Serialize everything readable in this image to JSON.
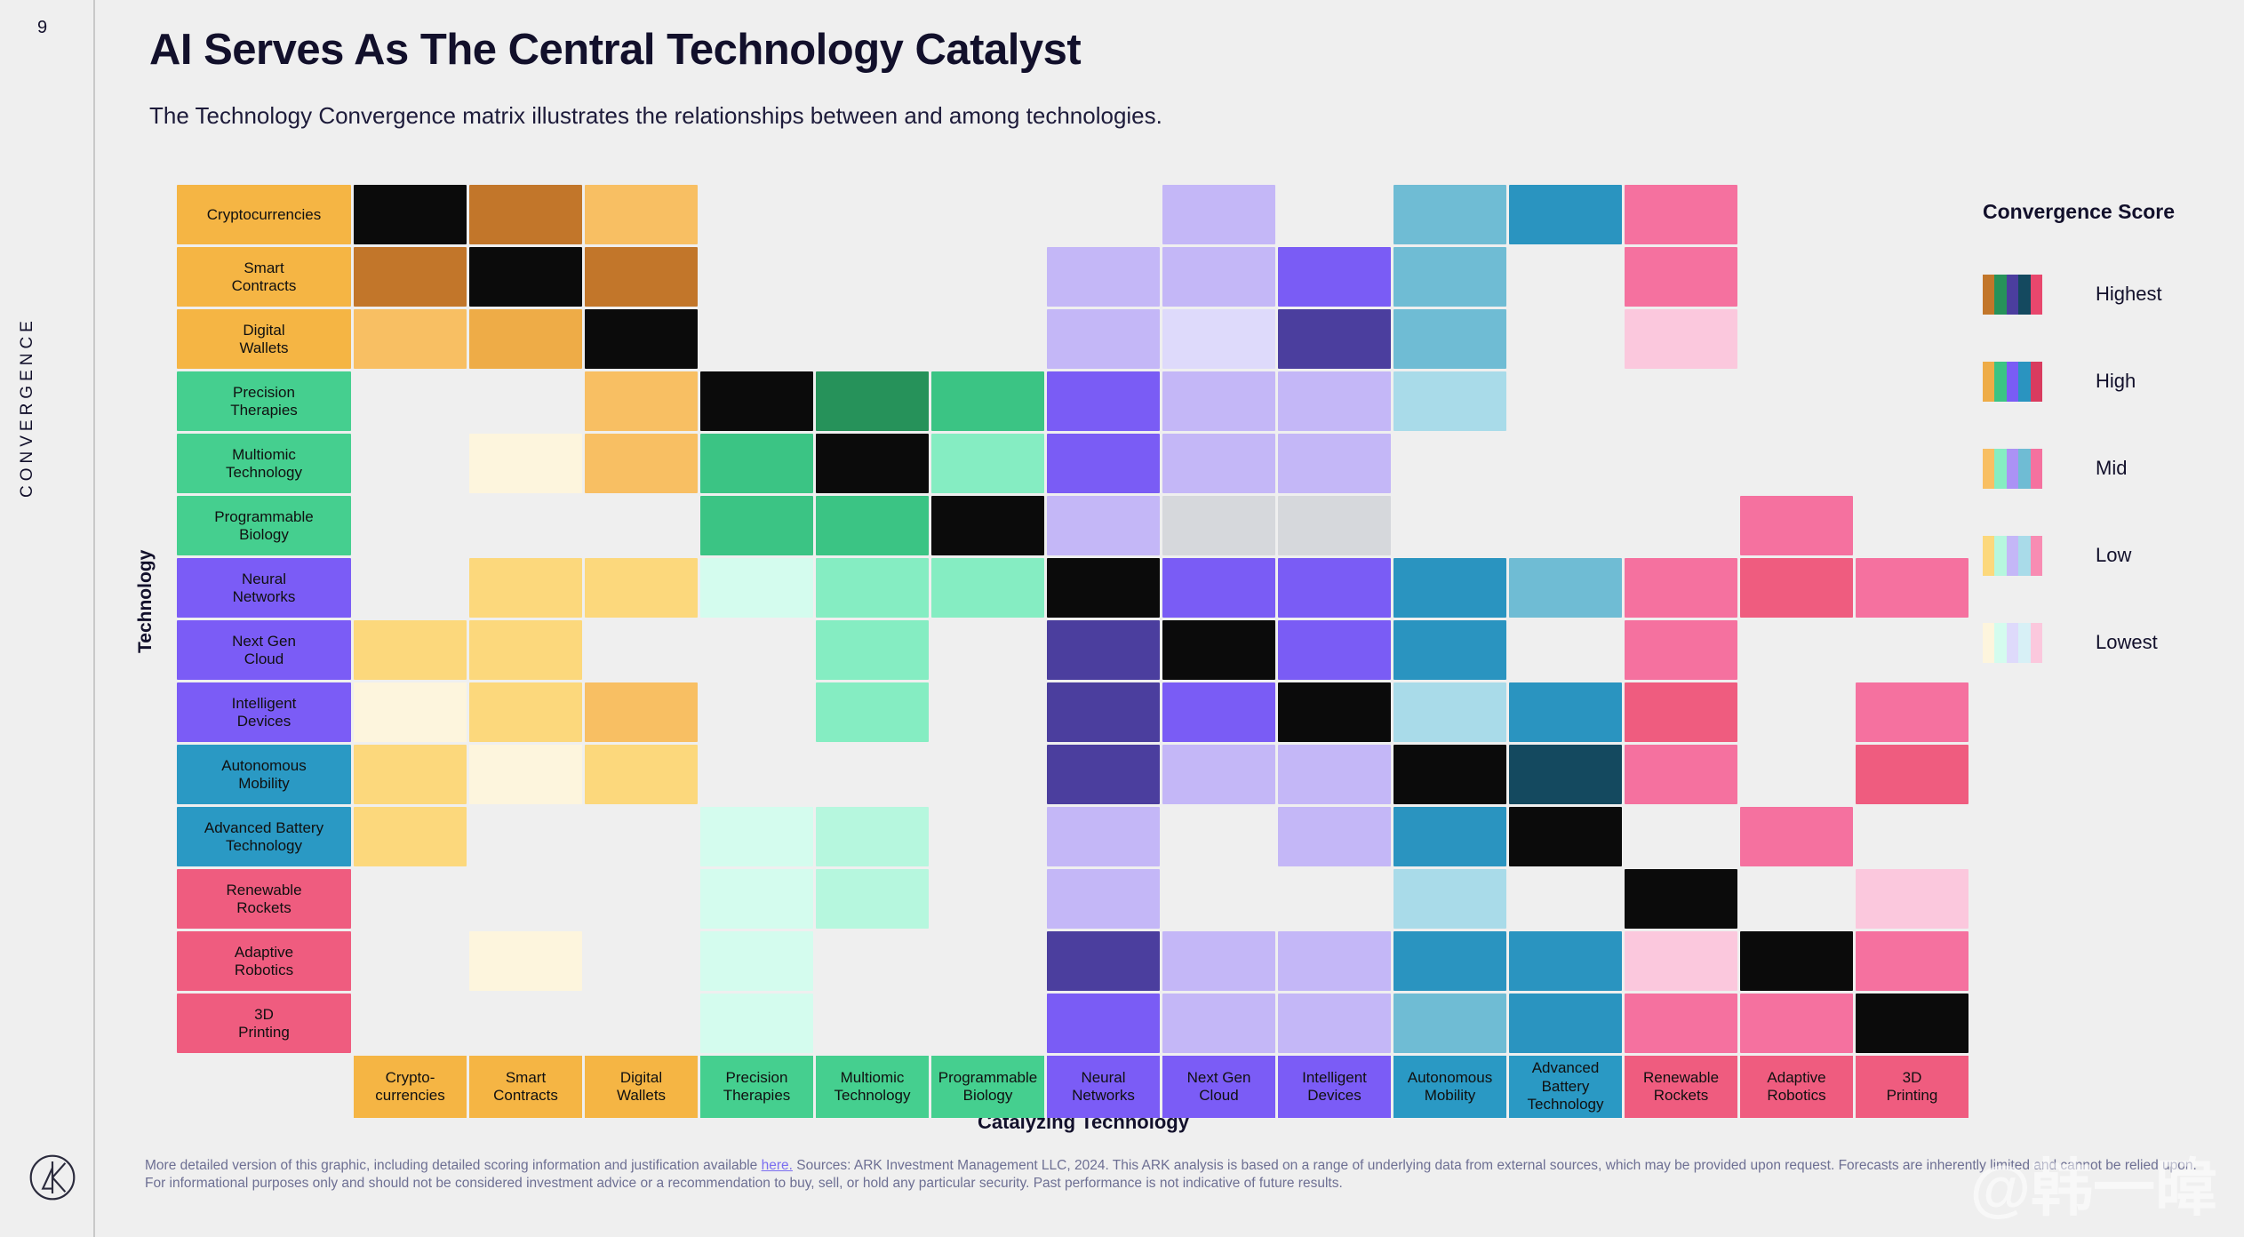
{
  "page_number": "9",
  "side_label": "CONVERGENCE",
  "title": "AI Serves As The Central Technology Catalyst",
  "subtitle": "The Technology Convergence matrix illustrates the relationships between and among technologies.",
  "axis": {
    "y_caption": "Technology",
    "x_caption": "Catalyzing Technology"
  },
  "legend": {
    "title": "Convergence Score",
    "items": [
      {
        "label": "Highest",
        "colors": [
          "#c2762a",
          "#26925a",
          "#4b3e9e",
          "#14495f",
          "#e8476d"
        ]
      },
      {
        "label": "High",
        "colors": [
          "#eeac47",
          "#3bc484",
          "#7a5cf5",
          "#2a94c0",
          "#d93b5f"
        ]
      },
      {
        "label": "Mid",
        "colors": [
          "#f8bf63",
          "#85edc2",
          "#ab92f5",
          "#6fbcd4",
          "#f5719f"
        ]
      },
      {
        "label": "Low",
        "colors": [
          "#fcd87c",
          "#b6f7de",
          "#c4b7f7",
          "#a9dbe9",
          "#f88cb3"
        ]
      },
      {
        "label": "Lowest",
        "colors": [
          "#fdf5dd",
          "#d4fcee",
          "#dedafb",
          "#d7f0f6",
          "#fbc8dd"
        ]
      }
    ]
  },
  "footer": {
    "part1": "More detailed version of this graphic, including detailed scoring information and justification available ",
    "link": "here.",
    "part2": " Sources: ARK Investment Management LLC, 2024. This ARK analysis is based on a range of underlying data from external sources, which may be provided upon request. Forecasts are inherently limited and cannot be relied upon. For informational purposes only and should not be considered investment advice or a recommendation to buy, sell, or hold any particular security. Past performance is not indicative of future results."
  },
  "watermark": "@韩一暐",
  "chart_data": {
    "type": "heatmap",
    "title": "AI Serves As The Central Technology Catalyst",
    "xlabel": "Catalyzing Technology",
    "ylabel": "Technology",
    "categories": [
      "Cryptocurrencies",
      "Smart Contracts",
      "Digital Wallets",
      "Precision Therapies",
      "Multiomic Technology",
      "Programmable Biology",
      "Neural Networks",
      "Next Gen Cloud",
      "Intelligent Devices",
      "Autonomous Mobility",
      "Advanced Battery Technology",
      "Renewable Rockets",
      "Adaptive Robotics",
      "3D Printing"
    ],
    "row_label_lines": [
      [
        "Cryptocurrencies"
      ],
      [
        "Smart",
        "Contracts"
      ],
      [
        "Digital",
        "Wallets"
      ],
      [
        "Precision",
        "Therapies"
      ],
      [
        "Multiomic",
        "Technology"
      ],
      [
        "Programmable",
        "Biology"
      ],
      [
        "Neural",
        "Networks"
      ],
      [
        "Next Gen",
        "Cloud"
      ],
      [
        "Intelligent",
        "Devices"
      ],
      [
        "Autonomous",
        "Mobility"
      ],
      [
        "Advanced Battery",
        "Technology"
      ],
      [
        "Renewable",
        "Rockets"
      ],
      [
        "Adaptive",
        "Robotics"
      ],
      [
        "3D",
        "Printing"
      ]
    ],
    "col_label_lines": [
      [
        "Crypto-",
        "currencies"
      ],
      [
        "Smart",
        "Contracts"
      ],
      [
        "Digital",
        "Wallets"
      ],
      [
        "Precision",
        "Therapies"
      ],
      [
        "Multiomic",
        "Technology"
      ],
      [
        "Programmable",
        "Biology"
      ],
      [
        "Neural",
        "Networks"
      ],
      [
        "Next Gen",
        "Cloud"
      ],
      [
        "Intelligent",
        "Devices"
      ],
      [
        "Autonomous",
        "Mobility"
      ],
      [
        "Advanced",
        "Battery",
        "Technology"
      ],
      [
        "Renewable",
        "Rockets"
      ],
      [
        "Adaptive",
        "Robotics"
      ],
      [
        "3D",
        "Printing"
      ]
    ],
    "group_colors": {
      "crypto": "#f5b544",
      "genomic": "#45cf8f",
      "ai": "#7b5cf6",
      "energy": "#2a99c4",
      "space": "#ef5c7f"
    },
    "row_group": [
      "crypto",
      "crypto",
      "crypto",
      "genomic",
      "genomic",
      "genomic",
      "ai",
      "ai",
      "ai",
      "energy",
      "energy",
      "space",
      "space",
      "space"
    ],
    "diagonal_color": "#0b0b0b",
    "scale_levels": [
      "none",
      "lowest",
      "low",
      "mid",
      "high",
      "highest"
    ],
    "palette": {
      "crypto": {
        "lowest": "#fdf5dd",
        "low": "#fcd87c",
        "mid": "#f8bf63",
        "high": "#eeac47",
        "highest": "#c2762a"
      },
      "genomic": {
        "lowest": "#d4fcee",
        "low": "#b6f7de",
        "mid": "#85edc2",
        "high": "#3bc484",
        "highest": "#26925a"
      },
      "ai": {
        "lowest": "#dedafb",
        "low": "#c4b7f7",
        "mid": "#ab92f5",
        "high": "#7a5cf5",
        "highest": "#4b3e9e"
      },
      "energy": {
        "lowest": "#d7f0f6",
        "low": "#a9dbe9",
        "mid": "#6fbcd4",
        "high": "#2a94c0",
        "highest": "#14495f"
      },
      "space": {
        "lowest": "#fbc8dd",
        "low": "#f88cb3",
        "mid": "#f5719f",
        "high": "#ef5c7f",
        "highest": "#d93b5f"
      }
    },
    "grey_cell": "#d6d8dc",
    "values": [
      [
        "diag",
        "highest",
        "mid",
        "none",
        "none",
        "none",
        "none",
        "low",
        "none",
        "mid",
        "high",
        "mid",
        "none",
        "none"
      ],
      [
        "highest",
        "diag",
        "highest",
        "none",
        "none",
        "none",
        "low",
        "low",
        "high",
        "mid",
        "none",
        "mid",
        "none",
        "none"
      ],
      [
        "mid",
        "high",
        "diag",
        "none",
        "none",
        "none",
        "low",
        "lowest",
        "highest",
        "mid",
        "none",
        "lowest",
        "none",
        "none"
      ],
      [
        "none",
        "none",
        "mid",
        "diag",
        "highest",
        "high",
        "high",
        "low",
        "low",
        "low",
        "none",
        "none",
        "none",
        "none"
      ],
      [
        "none",
        "lowest",
        "mid",
        "high",
        "diag",
        "mid",
        "high",
        "low",
        "low",
        "none",
        "none",
        "none",
        "none",
        "none"
      ],
      [
        "none",
        "none",
        "none",
        "high",
        "high",
        "diag",
        "low",
        "grey",
        "grey",
        "none",
        "none",
        "none",
        "mid",
        "none"
      ],
      [
        "none",
        "low",
        "low",
        "lowest",
        "mid",
        "mid",
        "diag",
        "high",
        "high",
        "high",
        "mid",
        "mid",
        "high",
        "mid"
      ],
      [
        "low",
        "low",
        "none",
        "none",
        "mid",
        "none",
        "highest",
        "diag",
        "high",
        "high",
        "none",
        "mid",
        "none",
        "none"
      ],
      [
        "lowest",
        "low",
        "mid",
        "none",
        "mid",
        "none",
        "highest",
        "high",
        "diag",
        "low",
        "high",
        "high",
        "none",
        "mid"
      ],
      [
        "low",
        "lowest",
        "low",
        "none",
        "none",
        "none",
        "highest",
        "low",
        "low",
        "diag",
        "highest",
        "mid",
        "none",
        "high"
      ],
      [
        "low",
        "none",
        "none",
        "lowest",
        "low",
        "none",
        "low",
        "none",
        "low",
        "high",
        "diag",
        "none",
        "mid",
        "none"
      ],
      [
        "none",
        "none",
        "none",
        "lowest",
        "low",
        "none",
        "low",
        "none",
        "none",
        "low",
        "none",
        "diag",
        "none",
        "lowest"
      ],
      [
        "none",
        "lowest",
        "none",
        "lowest",
        "none",
        "none",
        "highest",
        "low",
        "low",
        "high",
        "high",
        "lowest",
        "diag",
        "mid"
      ],
      [
        "none",
        "none",
        "none",
        "lowest",
        "none",
        "none",
        "high",
        "low",
        "low",
        "mid",
        "high",
        "mid",
        "mid",
        "diag"
      ]
    ]
  }
}
